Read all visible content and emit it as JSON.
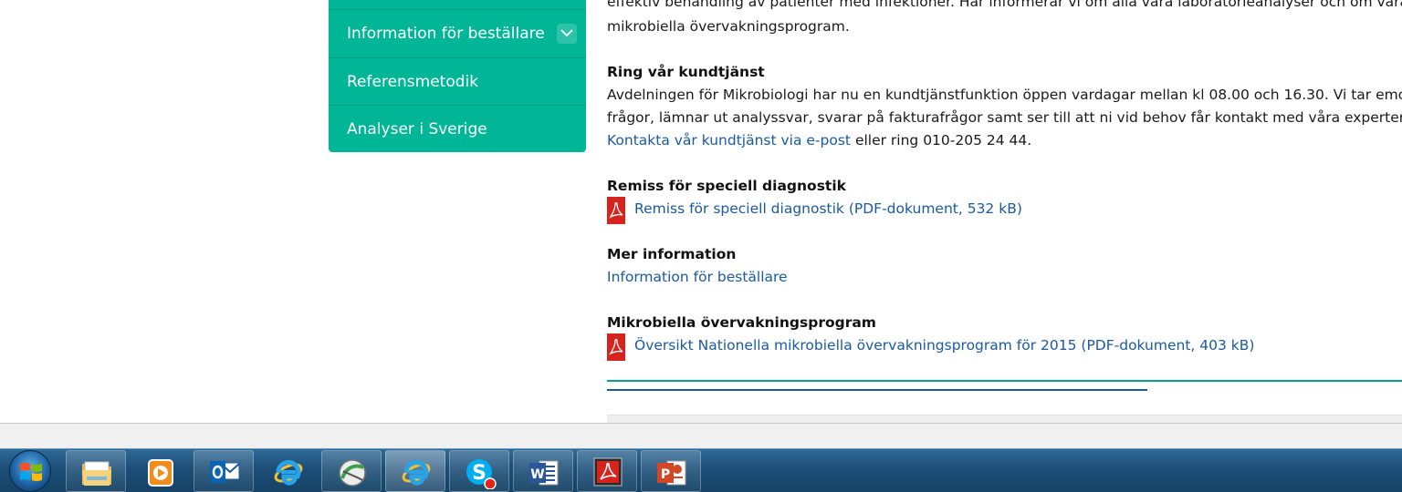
{
  "sidebar": {
    "items": [
      {
        "label": "Information för beställare"
      },
      {
        "label": "Referensmetodik"
      },
      {
        "label": "Analyser i Sverige"
      }
    ],
    "expand_icon": "chevron-down-icon"
  },
  "content": {
    "intro_line1": "effektiv behandling av patienter med infektioner. Här informerar vi om alla våra laboratorieanalyser och om våra nationella",
    "intro_line2": "mikrobiella övervakningsprogram.",
    "kundtjanst": {
      "heading": "Ring vår kundtjänst",
      "line1": "Avdelningen för Mikrobiologi har nu en kundtjänstfunktion öppen vardagar mellan kl 08.00 och 16.30. Vi tar emot era",
      "line2": "frågor, lämnar ut analyssvar, svarar på fakturafrågor samt ser till att ni vid behov får kontakt med våra experter.",
      "link": "Kontakta vår kundtjänst via e-post",
      "after_link": " eller ring 010-205 24 44."
    },
    "remiss": {
      "heading": "Remiss för speciell diagnostik",
      "pdf_link": "Remiss för speciell diagnostik (PDF-dokument, 532 kB)"
    },
    "mer_info": {
      "heading": "Mer information",
      "link": "Information för beställare"
    },
    "overvakning": {
      "heading": "Mikrobiella övervakningsprogram",
      "pdf_link": "Översikt Nationella mikrobiella övervakningsprogram för 2015 (PDF-dokument, 403 kB)"
    }
  },
  "taskbar": {
    "items": [
      {
        "name": "windows-explorer",
        "icon": "folder-icon"
      },
      {
        "name": "media-player",
        "icon": "media-play-icon"
      },
      {
        "name": "outlook",
        "icon": "outlook-icon"
      },
      {
        "name": "internet-explorer",
        "icon": "ie-icon"
      },
      {
        "name": "network-app",
        "icon": "globe-icon"
      },
      {
        "name": "internet-explorer-active",
        "icon": "ie-icon"
      },
      {
        "name": "skype",
        "icon": "skype-icon"
      },
      {
        "name": "word",
        "icon": "word-icon"
      },
      {
        "name": "acrobat",
        "icon": "acrobat-icon"
      },
      {
        "name": "powerpoint",
        "icon": "powerpoint-icon"
      }
    ]
  },
  "colors": {
    "sidebar_bg": "#00b696",
    "link": "#1a5aa0",
    "rule_teal": "#00a58a",
    "rule_blue": "#1a5aa0",
    "pdf_red": "#d7231e"
  }
}
